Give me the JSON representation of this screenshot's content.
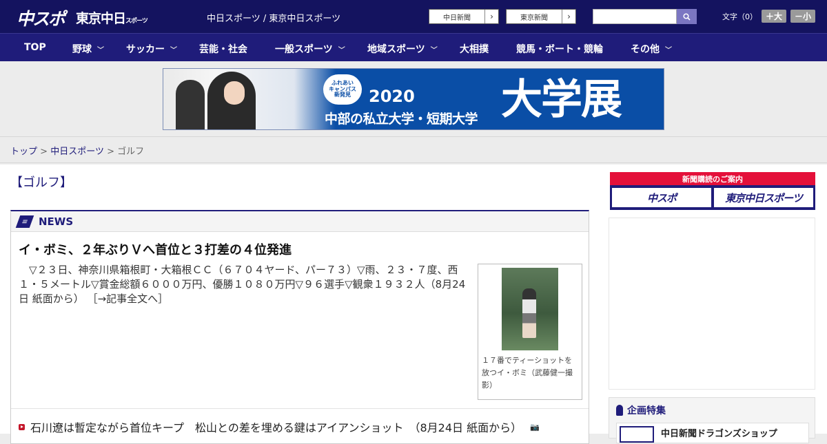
{
  "header": {
    "logo_chuspo": "中スポ",
    "logo_tokyo": "東京中日",
    "logo_tokyo_small": "スポーツ",
    "site_title": "中日スポーツ / 東京中日スポーツ",
    "paper_buttons": [
      "中日新聞",
      "東京新聞"
    ],
    "search_icon": "search-icon",
    "font_label": "文字（0）",
    "font_up": "＋大",
    "font_down": "－小"
  },
  "nav": {
    "items": [
      {
        "label": "TOP",
        "dropdown": false
      },
      {
        "label": "野球",
        "dropdown": true
      },
      {
        "label": "サッカー",
        "dropdown": true
      },
      {
        "label": "芸能・社会",
        "dropdown": false
      },
      {
        "label": "一般スポーツ",
        "dropdown": true
      },
      {
        "label": "地域スポーツ",
        "dropdown": true
      },
      {
        "label": "大相撲",
        "dropdown": false
      },
      {
        "label": "競馬・ボート・競輪",
        "dropdown": false
      },
      {
        "label": "その他",
        "dropdown": true
      }
    ]
  },
  "banner": {
    "badge": [
      "ふれあい",
      "キャンパス",
      "新発見"
    ],
    "year": "2020",
    "subtitle": "中部の私立大学・短期大学",
    "big": "大学展"
  },
  "breadcrumb": {
    "top": "トップ",
    "sep": ">",
    "site": "中日スポーツ",
    "current": "ゴルフ"
  },
  "category": "【ゴルフ】",
  "news": {
    "heading": "NEWS",
    "title": "イ・ボミ、２年ぶりＶへ首位と３打差の４位発進",
    "body": "▽２３日、神奈川県箱根町・大箱根ＣＣ（６７０４ヤード、パー７３）▽雨、２３・７度、西１・５メートル▽賞金総額６０００万円、優勝１０８０万円▽９６選手▽観衆１９３２人（8月24日 紙面から）",
    "more": "［→記事全文へ］",
    "photo_caption": "１７番でティーショットを放つイ・ボミ（武藤健一撮影）",
    "list": [
      {
        "title": "石川遼は暫定ながら首位キープ　松山との差を埋める鍵はアイアンショット",
        "date": "（8月24日 紙面から）",
        "icon": "camera-icon"
      }
    ]
  },
  "sidebar": {
    "subscribe_label": "新聞購読のご案内",
    "subscribe_buttons": [
      "中スポ",
      "東京中日スポーツ"
    ],
    "feature_heading": "企画特集",
    "feature_item": "中日新聞ドラゴンズショップ"
  },
  "colors": {
    "header_bg": "#14135f",
    "nav_bg": "#1f1c7a",
    "accent_red": "#e4103a",
    "banner_blue": "#0a4ea6"
  }
}
